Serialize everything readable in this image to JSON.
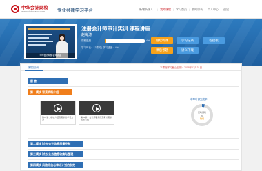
{
  "header": {
    "logo_name": "中华会计网校",
    "logo_url": "www.chinaacc.com",
    "platform": "专业共建学习平台",
    "nav": [
      "新增听课人",
      "我的课程",
      "学习首页",
      "我的课表",
      "个人中心",
      "退出"
    ],
    "nav_current": "我的课程"
  },
  "banner": {
    "thumb_caption": "中华会计网校 名师讲座",
    "course_title": "注册会计师审计实训 课程讲座",
    "teacher": "赵海涛",
    "progress_label": "课程进度",
    "progress_value": "4%",
    "progress_fraction": 0.04,
    "stats": "学习时长：12课时 | 学习进度：4%",
    "buttons": [
      "继续听课",
      "学习记录",
      "答疑板",
      "讲义下载",
      "课后考题",
      "退出学习"
    ]
  },
  "content": {
    "tab": "课程目录",
    "notice": "本课程学习截止日期：2018年12月31日",
    "sections": [
      {
        "label": "前  言"
      },
      {
        "label": "第一模块    背景资料介绍"
      },
      {
        "label": "第二模块    财务 会计信息质量控制"
      },
      {
        "label": "第三模块    财务 业务信息收集与整理"
      },
      {
        "label": "第四模块    风险评估与审计计划的制定"
      }
    ],
    "videos": [
      {
        "title": "第01讲：模块介绍及实训的学习方法"
      },
      {
        "title": "第02讲：会计师事务所及审计实训背景介绍"
      }
    ],
    "rate_label": "本章听课完成率",
    "rate_value": "4%",
    "rate_fraction": 0.04,
    "rate_text": "已听课时",
    "rate_sub": "完成率",
    "rate_level": "较低"
  },
  "colors": {
    "brand_red": "#c8161d",
    "banner_blue": "#2d7bbf",
    "accent_orange": "#f07e1b",
    "section_blue": "#2f6fb4"
  }
}
